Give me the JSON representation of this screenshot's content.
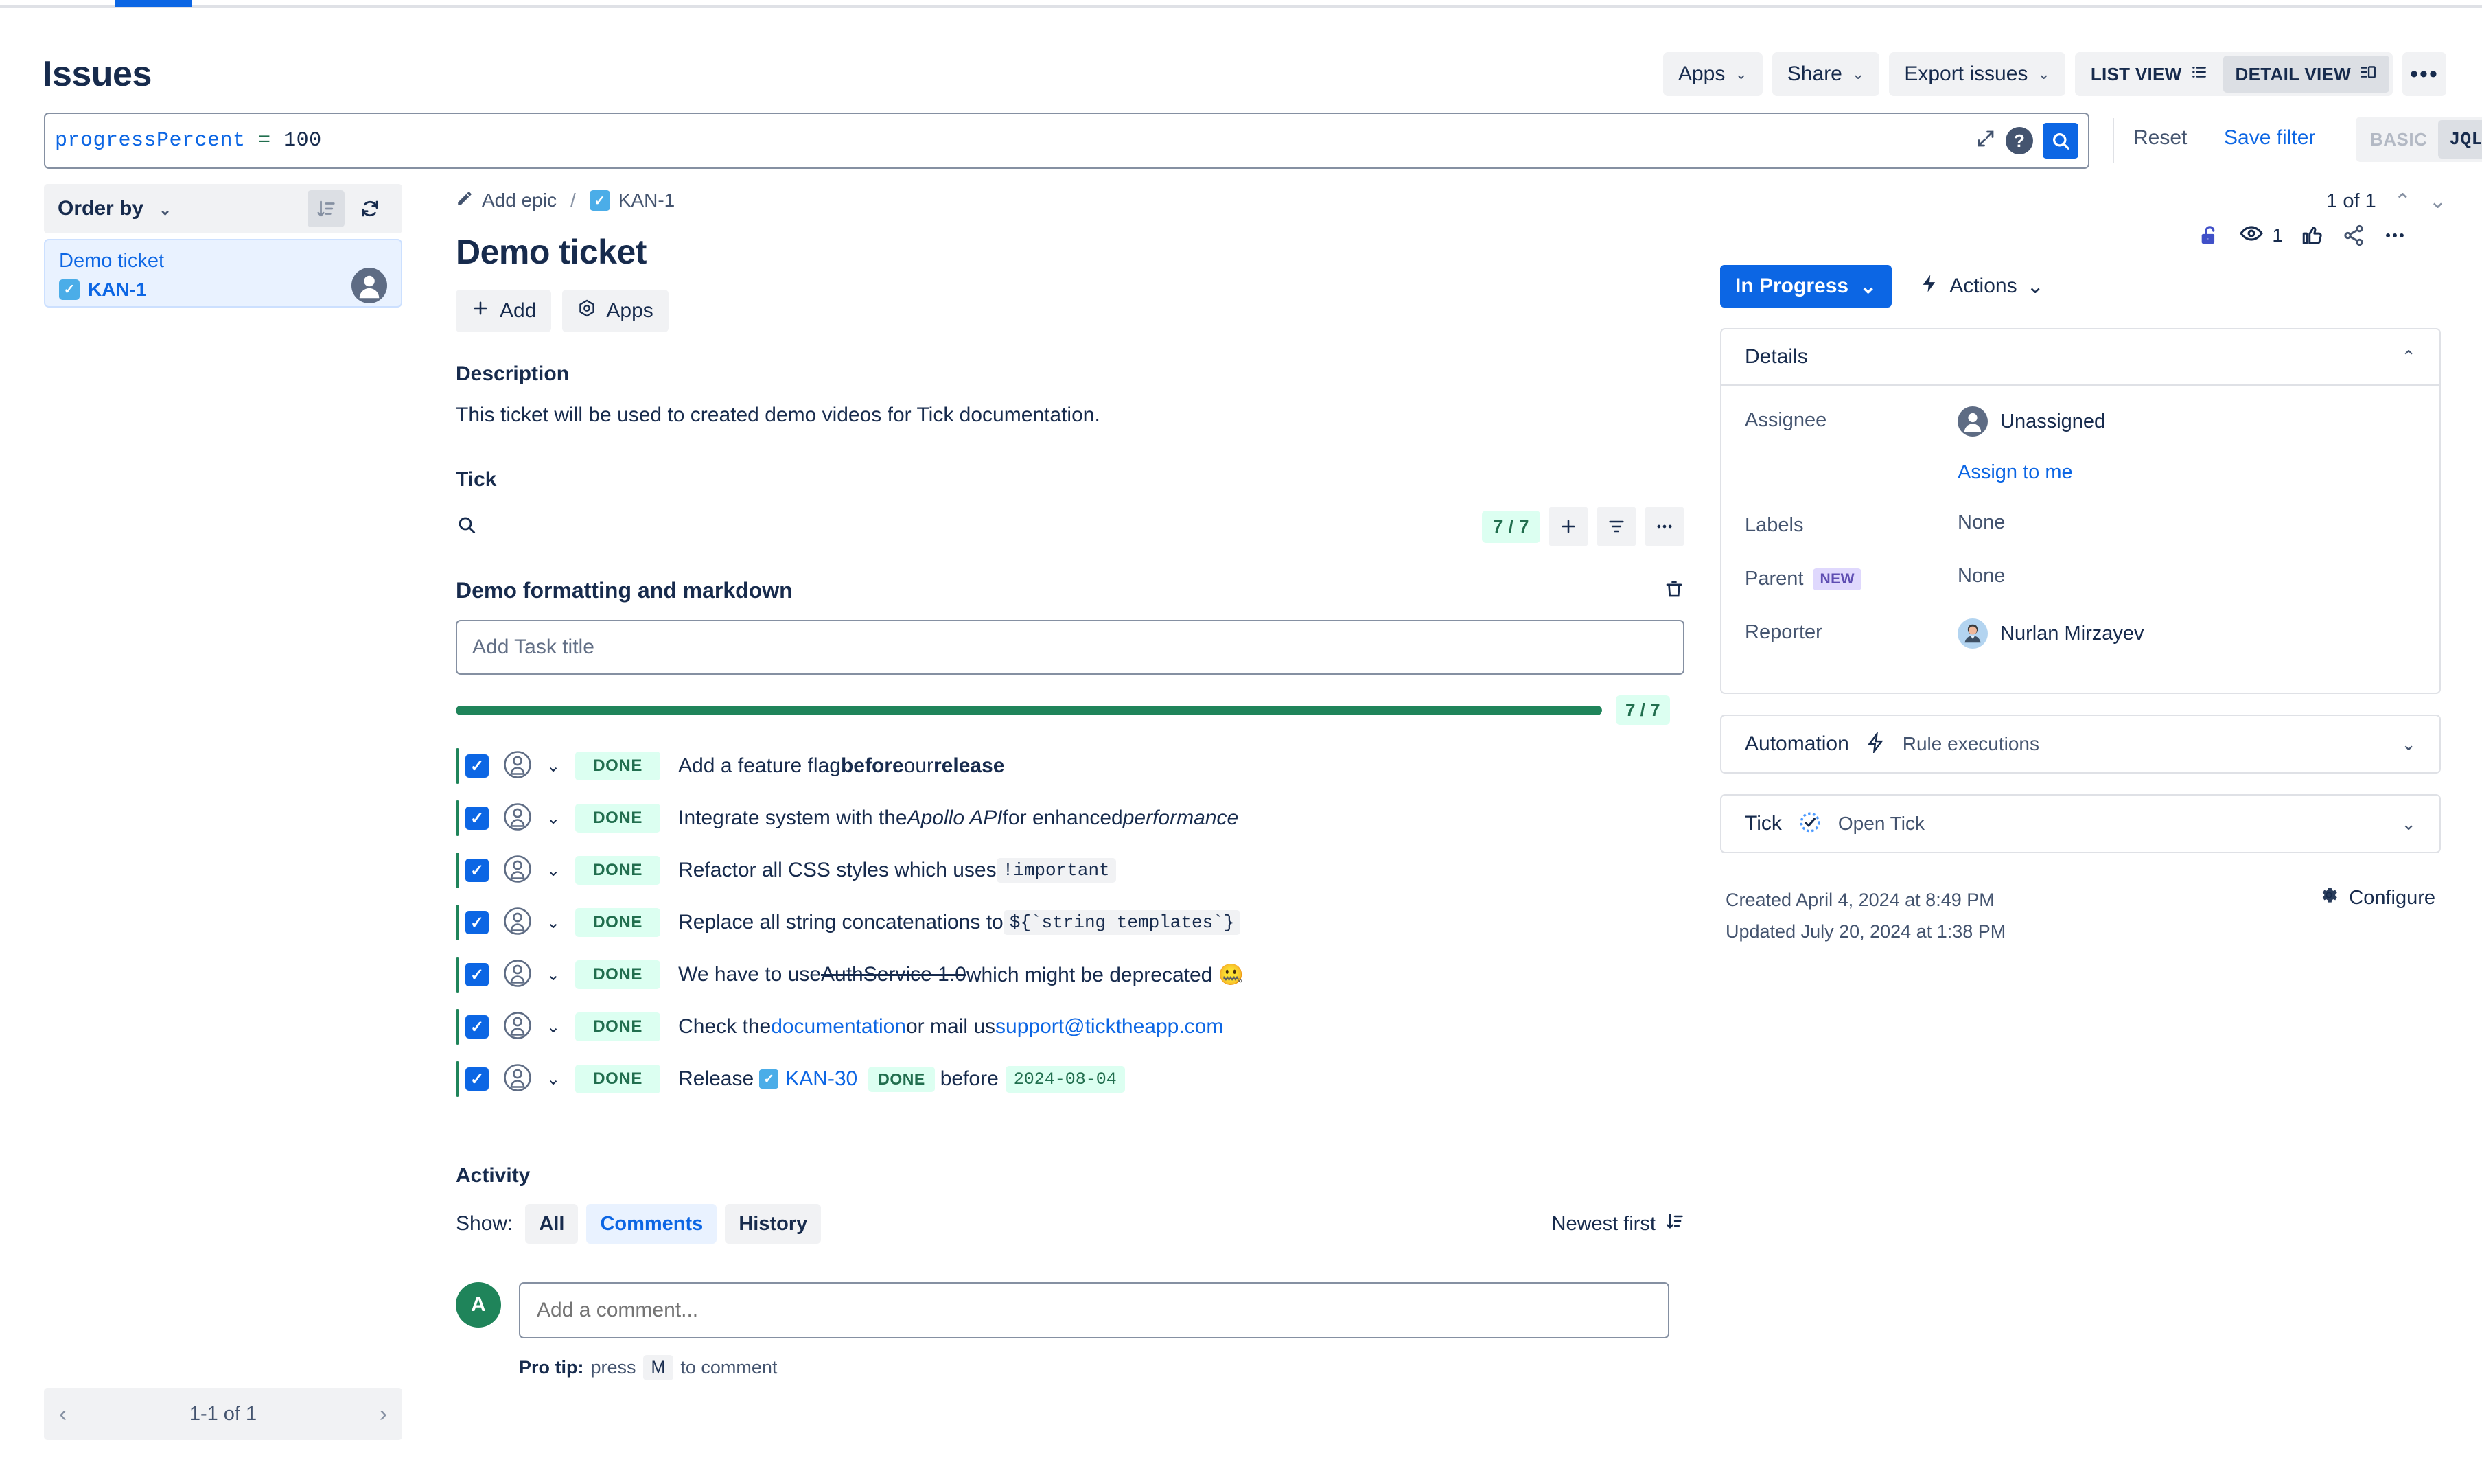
{
  "header": {
    "title": "Issues",
    "buttons": [
      {
        "label": "Apps",
        "caret": true
      },
      {
        "label": "Share",
        "caret": true
      },
      {
        "label": "Export issues",
        "caret": true
      }
    ],
    "view_toggle": {
      "list": "LIST VIEW",
      "detail": "DETAIL VIEW",
      "active": "DETAIL VIEW"
    },
    "more_label": "•••"
  },
  "search": {
    "jql_field": "progressPercent",
    "jql_operator": "=",
    "jql_value": "100",
    "reset_label": "Reset",
    "save_filter_label": "Save filter",
    "mode_basic": "BASIC",
    "mode_jql": "JQL",
    "mode_active": "JQL"
  },
  "sidebar": {
    "order_by_label": "Order by",
    "issues": [
      {
        "title": "Demo ticket",
        "key": "KAN-1"
      }
    ],
    "footer_count": "1-1 of 1"
  },
  "pager": {
    "label": "1 of 1"
  },
  "issue": {
    "breadcrumb": {
      "epic": "Add epic",
      "separator": "/",
      "key": "KAN-1"
    },
    "title": "Demo ticket",
    "actions": [
      {
        "label": "Add",
        "icon": "plus-icon"
      },
      {
        "label": "Apps",
        "icon": "apps-icon"
      }
    ],
    "description_label": "Description",
    "description_text": "This ticket will be used to created demo videos for Tick documentation.",
    "watch_count": "1"
  },
  "tick": {
    "heading": "Tick",
    "count_pill": "7 / 7",
    "checklist_title": "Demo formatting and markdown",
    "task_input_placeholder": "Add Task title",
    "progress_label": "7 / 7",
    "progress_percent": 100,
    "tasks": [
      {
        "status": "DONE",
        "text_html": "Add a feature flag <b>before</b> our <b>release</b>"
      },
      {
        "status": "DONE",
        "text_html": "Integrate system with the <i>Apollo API</i> for enhanced <i>performance</i>"
      },
      {
        "status": "DONE",
        "text_html": "Refactor all CSS styles which uses <span class=\"code\">!important</span>"
      },
      {
        "status": "DONE",
        "text_html": "Replace all string concatenations to <span class=\"code\">${`string templates`}</span>"
      },
      {
        "status": "DONE",
        "text_html": "We have to use <s>AuthService 1.0</s> which might be deprecated 🤐"
      },
      {
        "status": "DONE",
        "text_html": "Check the <span class=\"lnk\">documentation</span> or mail us <span class=\"lnk\">support@ticktheapp.com</span>"
      },
      {
        "status": "DONE",
        "text_html": "Release <span class=\"inl-chip\"><span class=\"inl-chk\">✓</span><span class=\"inl-key\">KAN-30</span><span class=\"inl-done\">DONE</span></span> before <span class=\"inl-date\">2024-08-04</span>"
      }
    ]
  },
  "activity": {
    "title": "Activity",
    "show_label": "Show:",
    "filters": [
      {
        "label": "All",
        "selected": false
      },
      {
        "label": "Comments",
        "selected": true
      },
      {
        "label": "History",
        "selected": false
      }
    ],
    "sort_label": "Newest first",
    "avatar_initial": "A",
    "comment_placeholder": "Add a comment...",
    "protip_prefix": "Pro tip:",
    "protip_mid": "press",
    "protip_key": "M",
    "protip_suffix": "to comment"
  },
  "details": {
    "status_button": "In Progress",
    "actions_button": "Actions",
    "card_title": "Details",
    "fields": [
      {
        "label": "Assignee",
        "value": "Unassigned",
        "has_avatar": true
      },
      {
        "label": "Labels",
        "value": "None"
      },
      {
        "label": "Parent",
        "badge": "NEW",
        "value": "None"
      },
      {
        "label": "Reporter",
        "value": "Nurlan Mirzayev",
        "has_avatar": true
      }
    ],
    "assign_to_me": "Assign to me",
    "automation": {
      "label": "Automation",
      "value": "Rule executions"
    },
    "tick_panel": {
      "label": "Tick",
      "value": "Open Tick"
    },
    "created": "Created April 4, 2024 at 8:49 PM",
    "updated": "Updated July 20, 2024 at 1:38 PM",
    "configure": "Configure"
  },
  "colors": {
    "brand_blue": "#0c66e4",
    "green": "#1f845a",
    "green_bg": "#dcfff1",
    "text": "#172b4d",
    "subtle": "#44546f"
  }
}
